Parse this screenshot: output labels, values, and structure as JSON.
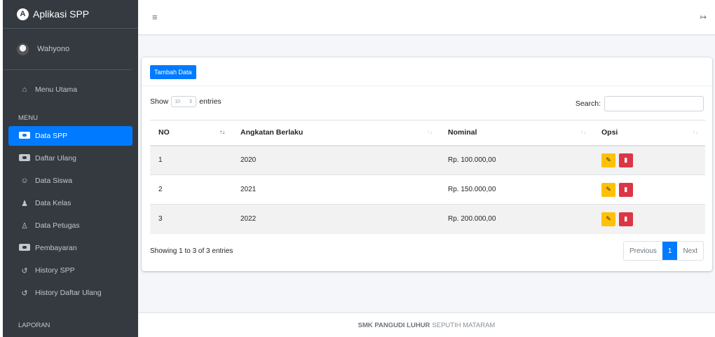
{
  "brand": {
    "title": "Aplikasi SPP",
    "logo_letter": "A"
  },
  "user": {
    "name": "Wahyono"
  },
  "sidebar": {
    "main_item": "Menu Utama",
    "section_menu": "MENU",
    "items": [
      {
        "label": "Data SPP",
        "icon": "money-card-icon",
        "active": true
      },
      {
        "label": "Daftar Ulang",
        "icon": "money-card-icon"
      },
      {
        "label": "Data Siswa",
        "icon": "users-icon"
      },
      {
        "label": "Data Kelas",
        "icon": "people-group-icon"
      },
      {
        "label": "Data Petugas",
        "icon": "user-icon"
      },
      {
        "label": "Pembayaran",
        "icon": "credit-card-icon"
      },
      {
        "label": "History SPP",
        "icon": "history-icon"
      },
      {
        "label": "History Daftar Ulang",
        "icon": "history-icon"
      }
    ],
    "section_report": "LAPORAN"
  },
  "toolbar": {
    "add_label": "Tambah Data"
  },
  "table_controls": {
    "show": "Show",
    "entries_value": "10",
    "entries": "entries",
    "search_label": "Search:"
  },
  "table": {
    "headers": [
      "NO",
      "Angkatan Berlaku",
      "Nominal",
      "Opsi"
    ],
    "rows": [
      {
        "no": "1",
        "angkatan": "2020",
        "nominal": "Rp. 100.000,00"
      },
      {
        "no": "2",
        "angkatan": "2021",
        "nominal": "Rp. 150.000,00"
      },
      {
        "no": "3",
        "angkatan": "2022",
        "nominal": "Rp. 200.000,00"
      }
    ]
  },
  "pagination": {
    "info": "Showing 1 to 3 of 3 entries",
    "previous": "Previous",
    "current": "1",
    "next": "Next"
  },
  "footer": {
    "school": "SMK PANGUDI LUHUR",
    "location": "SEPUTIH MATARAM"
  },
  "colors": {
    "primary": "#007bff",
    "sidebar": "#343a40",
    "warning": "#ffc107",
    "danger": "#dc3545"
  }
}
